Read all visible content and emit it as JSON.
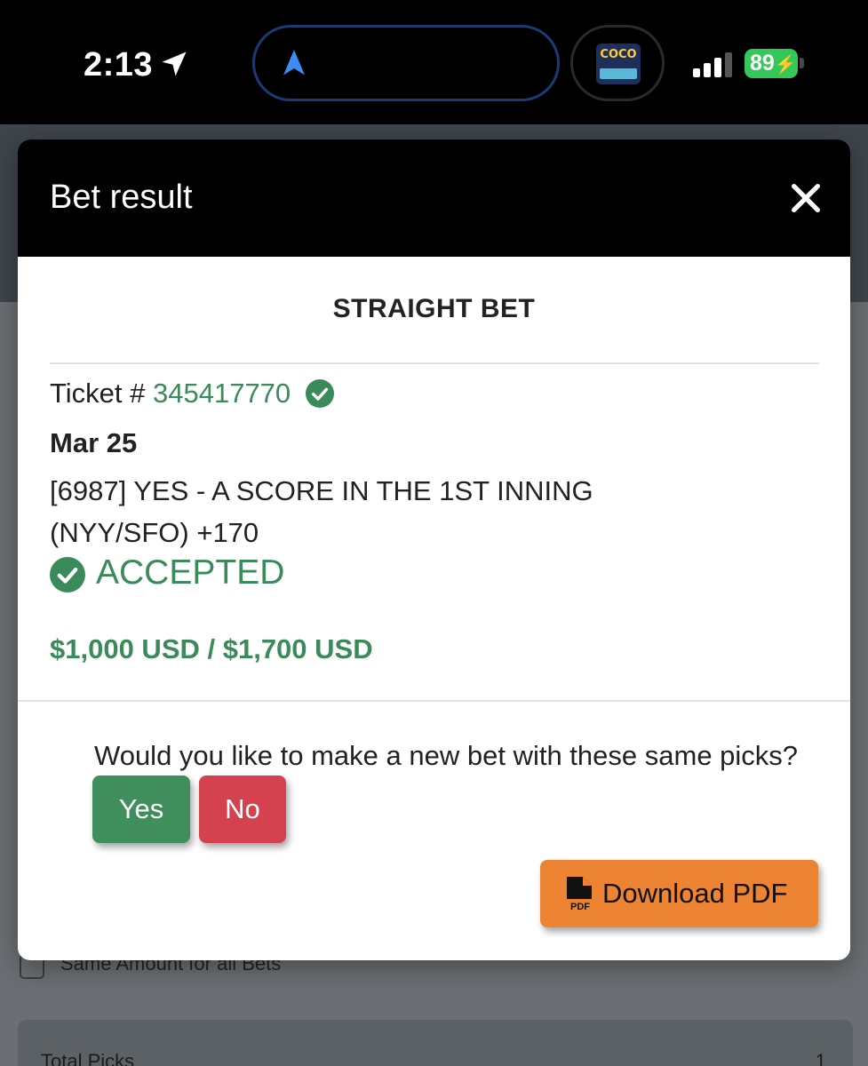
{
  "status_bar": {
    "time": "2:13",
    "battery": "89",
    "album_art_text": "COCO"
  },
  "background": {
    "same_amount_label": "Same Amount for all Bets",
    "total_picks_label": "Total Picks",
    "total_picks_value": "1"
  },
  "modal": {
    "title": "Bet result",
    "bet_type": "STRAIGHT BET",
    "ticket_label": "Ticket # ",
    "ticket_number": "345417770",
    "date": "Mar 25",
    "description": "[6987] YES - A SCORE IN THE 1ST INNING (NYY/SFO) +170",
    "status": "ACCEPTED",
    "amounts": "$1,000 USD / $1,700 USD",
    "question": "Would you like to make a new bet with these same picks?",
    "yes_label": "Yes",
    "no_label": "No",
    "download_label": "Download PDF",
    "pdf_icon_text": "PDF"
  },
  "colors": {
    "accent_green": "#3a8a5a",
    "yes_green": "#3f8e5c",
    "no_red": "#d44250",
    "pdf_orange": "#ec8434"
  },
  "icons": {
    "location": "location-arrow-icon",
    "navigation": "navigation-arrow-icon",
    "signal": "cellular-signal-icon",
    "battery": "battery-charging-icon",
    "close": "close-icon",
    "verified": "check-circle-icon",
    "pdf": "file-pdf-icon"
  }
}
